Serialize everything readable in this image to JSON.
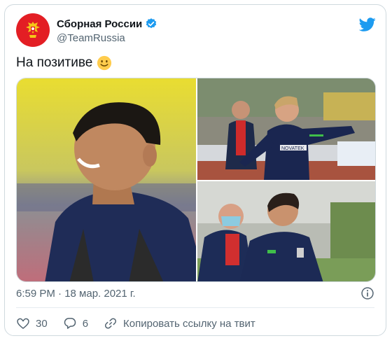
{
  "author": {
    "display_name": "Сборная России",
    "handle": "@TeamRussia",
    "verified": true,
    "avatar_icon": "russia-coat-of-arms-icon"
  },
  "tweet": {
    "text": "На позитиве",
    "emoji": "slightly-smiling-face"
  },
  "media": {
    "photos": [
      {
        "label": "photo-1"
      },
      {
        "label": "photo-2",
        "jersey_text": "NOVATEK"
      },
      {
        "label": "photo-3"
      }
    ]
  },
  "meta": {
    "timestamp": "6:59 PM · 18 мар. 2021 г."
  },
  "actions": {
    "likes": "30",
    "replies": "6",
    "copy_link_label": "Копировать ссылку на твит"
  },
  "colors": {
    "twitter_blue": "#1d9bf0",
    "text_secondary": "#536471",
    "avatar_red": "#e31e24"
  }
}
